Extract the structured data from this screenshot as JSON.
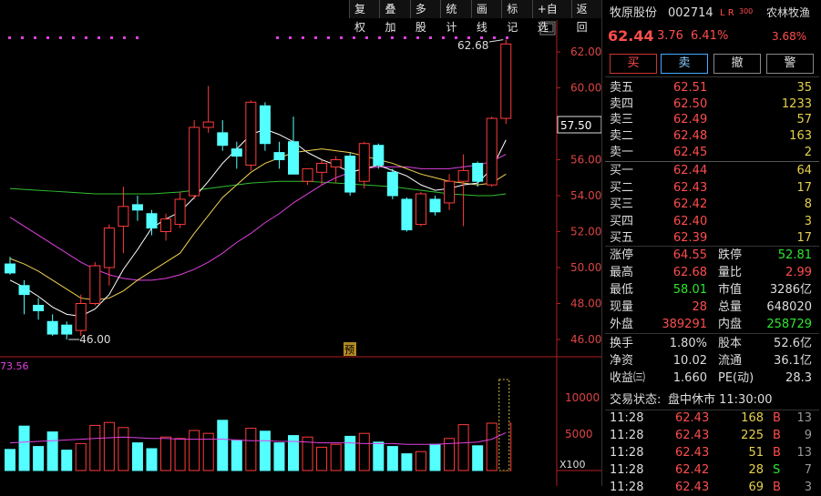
{
  "toolbar": {
    "items": [
      "复权",
      "叠加",
      "多股",
      "统计",
      "画线",
      "标记",
      "+自选",
      "返回"
    ]
  },
  "chart": {
    "price_labels": [
      "62.00",
      "60.00",
      "58.00",
      "56.00",
      "54.00",
      "52.00",
      "50.00",
      "48.00",
      "46.00"
    ],
    "current_price_tag": "57.50",
    "high_annotation": "62.68",
    "low_annotation": "46.00",
    "marker_label": "预",
    "vol_left_value": "73.56",
    "vol_labels": [
      "10000",
      "5000"
    ],
    "vol_unit": "X100",
    "colors": {
      "up": "#ff3b3b",
      "down": "#54ffff",
      "ma5": "#ffffff",
      "ma10": "#f0d050",
      "ma20": "#e040e0",
      "ma60": "#30c030",
      "dots": "#e040e0"
    }
  },
  "chart_data": {
    "type": "candlestick",
    "candles": [
      {
        "o": 50.2,
        "h": 50.6,
        "l": 49.6,
        "c": 49.7
      },
      {
        "o": 49.0,
        "h": 49.3,
        "l": 47.4,
        "c": 48.5
      },
      {
        "o": 47.9,
        "h": 48.3,
        "l": 47.1,
        "c": 47.6
      },
      {
        "o": 47.0,
        "h": 47.4,
        "l": 46.2,
        "c": 46.3
      },
      {
        "o": 46.8,
        "h": 47.0,
        "l": 46.0,
        "c": 46.3
      },
      {
        "o": 46.5,
        "h": 48.5,
        "l": 46.2,
        "c": 48.0
      },
      {
        "o": 48.0,
        "h": 50.3,
        "l": 47.9,
        "c": 50.1
      },
      {
        "o": 50.0,
        "h": 52.4,
        "l": 49.0,
        "c": 52.2
      },
      {
        "o": 52.3,
        "h": 54.5,
        "l": 50.8,
        "c": 53.4
      },
      {
        "o": 53.5,
        "h": 54.0,
        "l": 52.6,
        "c": 53.2
      },
      {
        "o": 53.0,
        "h": 53.2,
        "l": 51.8,
        "c": 52.2
      },
      {
        "o": 52.0,
        "h": 53.0,
        "l": 51.5,
        "c": 52.7
      },
      {
        "o": 52.4,
        "h": 54.2,
        "l": 52.2,
        "c": 53.8
      },
      {
        "o": 54.0,
        "h": 58.2,
        "l": 53.8,
        "c": 57.8
      },
      {
        "o": 57.8,
        "h": 60.1,
        "l": 57.5,
        "c": 58.1
      },
      {
        "o": 57.5,
        "h": 58.2,
        "l": 56.5,
        "c": 56.8
      },
      {
        "o": 56.6,
        "h": 57.0,
        "l": 55.5,
        "c": 56.2
      },
      {
        "o": 55.7,
        "h": 59.3,
        "l": 55.4,
        "c": 59.2
      },
      {
        "o": 59.0,
        "h": 59.2,
        "l": 56.5,
        "c": 56.9
      },
      {
        "o": 56.4,
        "h": 57.0,
        "l": 55.5,
        "c": 56.0
      },
      {
        "o": 57.0,
        "h": 58.4,
        "l": 55.2,
        "c": 55.2
      },
      {
        "o": 54.8,
        "h": 55.5,
        "l": 54.6,
        "c": 55.5
      },
      {
        "o": 55.3,
        "h": 56.0,
        "l": 54.6,
        "c": 55.8
      },
      {
        "o": 55.6,
        "h": 56.2,
        "l": 54.7,
        "c": 56.0
      },
      {
        "o": 56.2,
        "h": 56.4,
        "l": 54.0,
        "c": 54.2
      },
      {
        "o": 54.8,
        "h": 57.0,
        "l": 54.4,
        "c": 56.9
      },
      {
        "o": 56.8,
        "h": 56.9,
        "l": 55.5,
        "c": 55.7
      },
      {
        "o": 55.3,
        "h": 55.5,
        "l": 53.8,
        "c": 54.0
      },
      {
        "o": 53.8,
        "h": 53.9,
        "l": 52.0,
        "c": 52.1
      },
      {
        "o": 52.4,
        "h": 54.2,
        "l": 52.3,
        "c": 54.1
      },
      {
        "o": 53.8,
        "h": 54.0,
        "l": 52.9,
        "c": 53.1
      },
      {
        "o": 53.6,
        "h": 55.2,
        "l": 53.2,
        "c": 54.8
      },
      {
        "o": 54.8,
        "h": 56.3,
        "l": 52.3,
        "c": 55.4
      },
      {
        "o": 55.8,
        "h": 55.9,
        "l": 54.5,
        "c": 54.8
      },
      {
        "o": 54.6,
        "h": 58.4,
        "l": 54.5,
        "c": 58.3
      },
      {
        "o": 58.3,
        "h": 62.68,
        "l": 58.0,
        "c": 62.44
      }
    ],
    "ma5": [
      49.3,
      48.9,
      48.4,
      47.8,
      47.4,
      47.3,
      47.7,
      48.5,
      49.9,
      51.0,
      52.2,
      52.7,
      53.1,
      53.9,
      54.8,
      55.8,
      56.6,
      57.4,
      57.7,
      57.4,
      57.0,
      56.4,
      56.0,
      55.7,
      55.3,
      55.5,
      55.7,
      55.4,
      55.1,
      54.6,
      54.3,
      54.4,
      54.6,
      54.7,
      55.5,
      57.1
    ],
    "ma10": [
      50.5,
      50.2,
      49.8,
      49.3,
      48.8,
      48.3,
      48.2,
      48.3,
      48.7,
      49.3,
      49.8,
      50.3,
      50.8,
      51.9,
      52.9,
      53.9,
      54.6,
      55.3,
      55.8,
      56.1,
      56.4,
      56.5,
      56.6,
      56.5,
      56.4,
      56.2,
      56.0,
      55.8,
      55.5,
      55.2,
      55.0,
      54.8,
      54.7,
      54.6,
      54.7,
      55.2
    ],
    "ma20": [
      52.8,
      52.3,
      51.8,
      51.3,
      50.8,
      50.3,
      49.9,
      49.6,
      49.4,
      49.3,
      49.3,
      49.4,
      49.6,
      49.9,
      50.3,
      50.8,
      51.4,
      51.9,
      52.5,
      53.0,
      53.6,
      54.1,
      54.6,
      55.0,
      55.3,
      55.5,
      55.6,
      55.6,
      55.6,
      55.5,
      55.5,
      55.5,
      55.6,
      55.7,
      55.9,
      56.3
    ],
    "ma60": [
      54.4,
      54.35,
      54.3,
      54.25,
      54.2,
      54.15,
      54.1,
      54.1,
      54.1,
      54.1,
      54.1,
      54.15,
      54.2,
      54.3,
      54.4,
      54.5,
      54.6,
      54.7,
      54.75,
      54.8,
      54.8,
      54.8,
      54.75,
      54.7,
      54.65,
      54.6,
      54.55,
      54.5,
      54.4,
      54.3,
      54.2,
      54.1,
      54.05,
      54.0,
      54.0,
      54.1
    ],
    "volume": [
      2900,
      6100,
      3300,
      5300,
      2800,
      3700,
      6200,
      6600,
      5900,
      3800,
      3000,
      4600,
      4400,
      5500,
      5100,
      6900,
      4100,
      5800,
      5400,
      3800,
      4800,
      4600,
      3200,
      3600,
      4700,
      5100,
      3900,
      3300,
      2300,
      2600,
      3600,
      4400,
      6300,
      3400,
      6500,
      6500,
      12500
    ],
    "vol_ma": [
      3800,
      3900,
      4000,
      4100,
      4200,
      4300,
      4400,
      4500,
      4600,
      4500,
      4400,
      4400,
      4300,
      4300,
      4300,
      4300,
      4200,
      4100,
      4100,
      4000,
      4000,
      3900,
      3800,
      3800,
      3800,
      3700,
      3700,
      3700,
      3600,
      3600,
      3600,
      3700,
      3800,
      3900,
      4300,
      5200
    ]
  },
  "quote": {
    "name": "牧原股份",
    "code": "002714",
    "tags": "L R",
    "tag_sup": "300",
    "sector": "农林牧渔",
    "sector_pct": "3.68%",
    "price": "62.44",
    "change": "3.76",
    "change_pct": "6.41%"
  },
  "actions": {
    "buy": "买",
    "sell": "卖",
    "cancel": "撤",
    "alert": "警"
  },
  "order_book": {
    "asks": [
      {
        "label": "卖五",
        "price": "62.51",
        "vol": "35"
      },
      {
        "label": "卖四",
        "price": "62.50",
        "vol": "1233"
      },
      {
        "label": "卖三",
        "price": "62.49",
        "vol": "57"
      },
      {
        "label": "卖二",
        "price": "62.48",
        "vol": "163"
      },
      {
        "label": "卖一",
        "price": "62.45",
        "vol": "2"
      }
    ],
    "bids": [
      {
        "label": "买一",
        "price": "62.44",
        "vol": "64"
      },
      {
        "label": "买二",
        "price": "62.43",
        "vol": "17"
      },
      {
        "label": "买三",
        "price": "62.42",
        "vol": "8"
      },
      {
        "label": "买四",
        "price": "62.40",
        "vol": "3"
      },
      {
        "label": "买五",
        "price": "62.39",
        "vol": "17"
      }
    ]
  },
  "stats": {
    "limit_up_label": "涨停",
    "limit_up": "64.55",
    "limit_down_label": "跌停",
    "limit_down": "52.81",
    "high_label": "最高",
    "high": "62.68",
    "vol_ratio_label": "量比",
    "vol_ratio": "2.99",
    "low_label": "最低",
    "low": "58.01",
    "mktcap_label": "市值",
    "mktcap": "3286亿",
    "now_vol_label": "现量",
    "now_vol": "28",
    "total_vol_label": "总量",
    "total_vol": "648020",
    "outer_label": "外盘",
    "outer": "389291",
    "inner_label": "内盘",
    "inner": "258729",
    "turnover_label": "换手",
    "turnover": "1.80%",
    "shares_label": "股本",
    "shares": "52.6亿",
    "nav_label": "净资",
    "nav": "10.02",
    "float_label": "流通",
    "float": "36.1亿",
    "eps_label": "收益㈢",
    "eps": "1.660",
    "pe_label": "PE(动)",
    "pe": "28.3"
  },
  "status": {
    "label": "交易状态:",
    "value": "盘中休市 11:30:00"
  },
  "ticks": [
    {
      "time": "11:28",
      "price": "62.43",
      "vol": "168",
      "bs": "B",
      "n": "13"
    },
    {
      "time": "11:28",
      "price": "62.43",
      "vol": "225",
      "bs": "B",
      "n": "9"
    },
    {
      "time": "11:28",
      "price": "62.43",
      "vol": "51",
      "bs": "B",
      "n": "13"
    },
    {
      "time": "11:28",
      "price": "62.42",
      "vol": "28",
      "bs": "S",
      "n": "7"
    },
    {
      "time": "11:28",
      "price": "62.43",
      "vol": "69",
      "bs": "B",
      "n": "3"
    }
  ]
}
